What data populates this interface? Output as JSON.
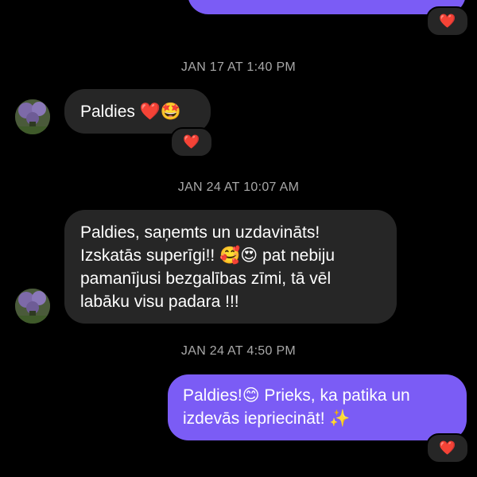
{
  "thread": {
    "reaction_emoji": "❤️",
    "top_message": {
      "text": "",
      "reaction": "❤️"
    },
    "timestamps": {
      "t1": "JAN 17 AT 1:40 PM",
      "t2": "JAN 24 AT 10:07 AM",
      "t3": "JAN 24 AT 4:50 PM"
    },
    "messages": [
      {
        "sender": "other",
        "text": "Paldies ❤️🤩",
        "reaction": "❤️"
      },
      {
        "sender": "other",
        "line1": "Paldies, saņemts un uzdavināts!",
        "line2": "Izskatās superīgi!! 🥰😍 pat nebiju",
        "line3": "pamanījusi bezgalības zīmi, tā vēl",
        "line4": "labāku visu padara !!!"
      },
      {
        "sender": "me",
        "line1": "Paldies!😊 Prieks, ka patika un",
        "line2": "izdevās iepriecināt! ✨",
        "reaction": "❤️"
      }
    ]
  },
  "colors": {
    "outgoing_bubble": "#7b5cf5",
    "incoming_bubble": "#262626",
    "timestamp": "#a8a8a8",
    "background": "#000000"
  }
}
